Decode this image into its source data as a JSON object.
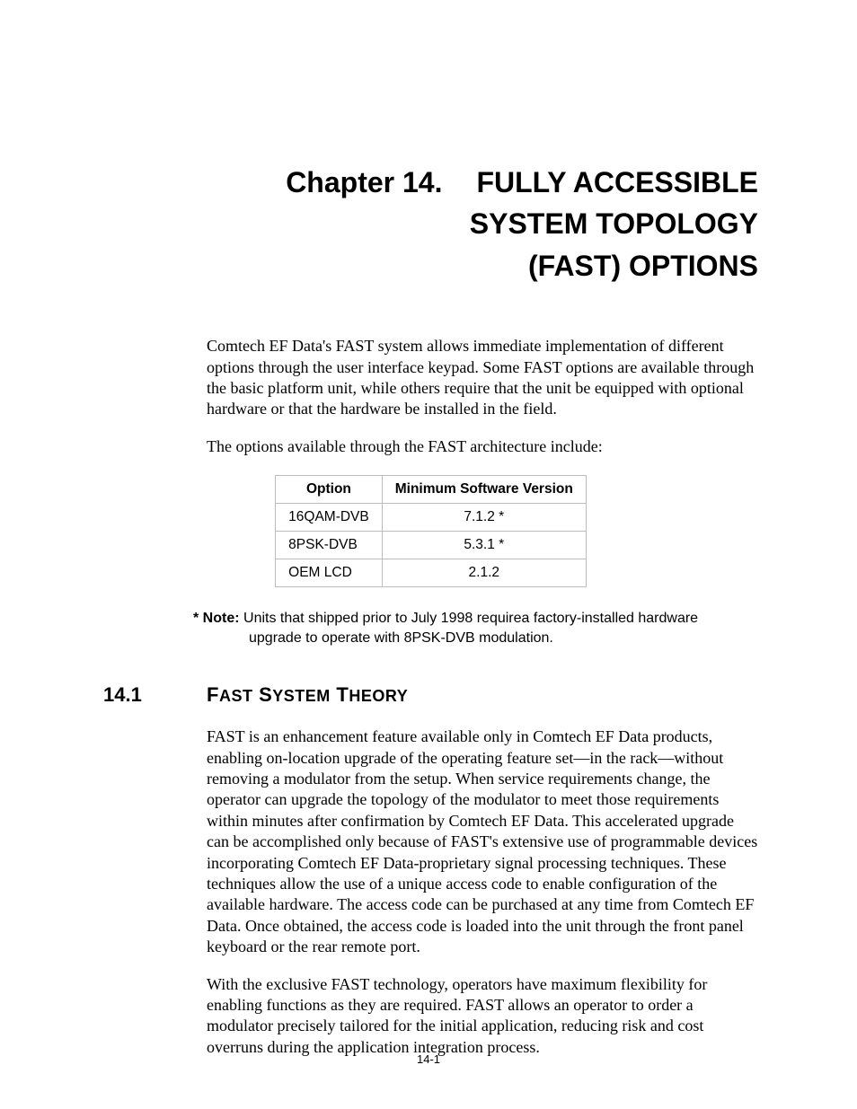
{
  "chapter": {
    "number_label": "Chapter 14.",
    "title_line1": "FULLY ACCESSIBLE",
    "title_line2": "SYSTEM TOPOLOGY",
    "title_line3": "(FAST) OPTIONS"
  },
  "intro_para1": "Comtech EF Data's FAST system allows immediate implementation of different options through the user interface keypad. Some FAST options are available through the basic platform unit, while others require that the unit be equipped with optional hardware or that the hardware be installed in the field.",
  "intro_para2": "The options available through the FAST architecture include:",
  "table": {
    "headers": [
      "Option",
      "Minimum Software Version"
    ],
    "rows": [
      {
        "option": "16QAM-DVB",
        "version": "7.1.2 *"
      },
      {
        "option": "8PSK-DVB",
        "version": "5.3.1 *"
      },
      {
        "option": "OEM LCD",
        "version": "2.1.2"
      }
    ]
  },
  "note_label": "* Note:",
  "note_text_line1": "Units that shipped prior to July 1998 requirea factory-installed hardware",
  "note_text_line2": "upgrade to operate with 8PSK-DVB modulation.",
  "section": {
    "number": "14.1",
    "title": "FAST System Theory"
  },
  "section_para1": "FAST is an enhancement feature available only in Comtech EF Data products, enabling on-location upgrade of the operating feature set—in the rack—without removing a modulator from the setup. When service requirements change, the operator can upgrade the topology of the modulator to meet those requirements within minutes after confirmation by Comtech EF Data. This accelerated upgrade can be accomplished only because of FAST's extensive use of programmable devices incorporating Comtech EF Data-proprietary signal processing techniques. These techniques allow the use of a unique access code to enable configuration of the available hardware. The access code can be purchased at any time from Comtech EF Data. Once obtained, the access code is loaded into the unit through the front panel keyboard or the rear remote port.",
  "section_para2": "With the exclusive FAST technology, operators have maximum flexibility for enabling functions as they are required. FAST allows an operator to order a modulator precisely tailored for the initial application, reducing risk and cost overruns during the application integration process.",
  "page_number": "14-1"
}
